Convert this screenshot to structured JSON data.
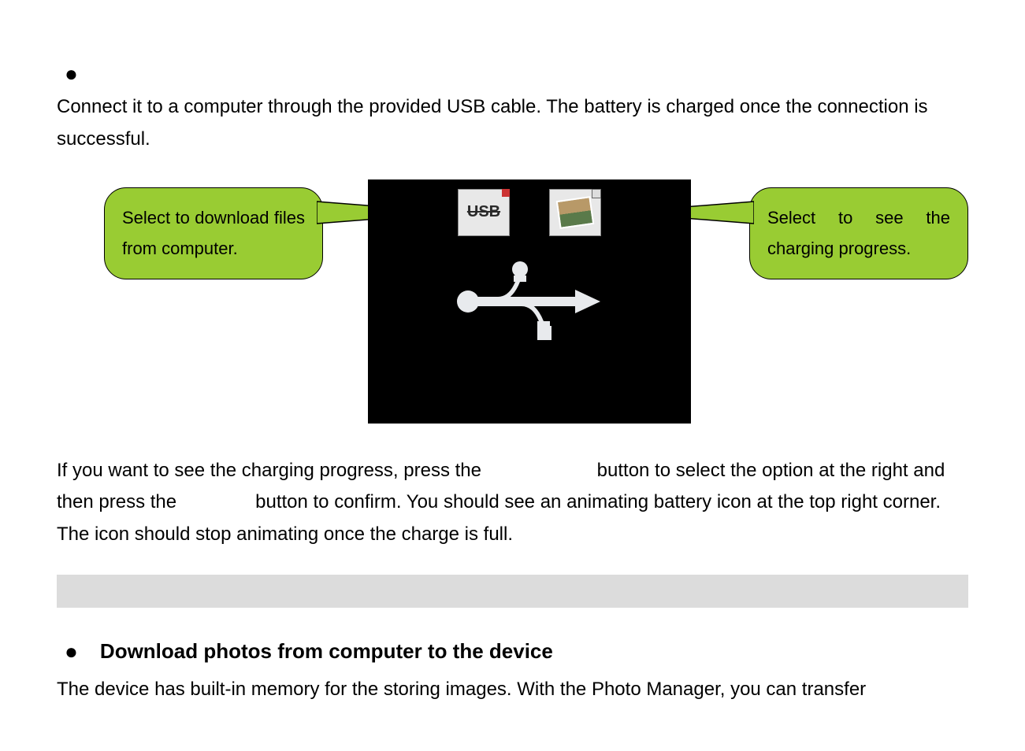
{
  "intro": {
    "text": "Connect it to a computer through the provided USB cable. The battery is charged once the connection is successful."
  },
  "callouts": {
    "left": "Select to download files from computer.",
    "right": "Select to see the charging progress."
  },
  "screen": {
    "usb_label": "USB"
  },
  "charging_para": "If you want to see the charging progress, press the                      button to select the option at the right and then press the               button to confirm. You should see an animating battery icon at the top right corner. The icon should stop animating once the charge is full.",
  "heading": "Download photos from computer to the device",
  "download_para": "The device has built-in memory for the storing images. With the Photo Manager, you can transfer"
}
